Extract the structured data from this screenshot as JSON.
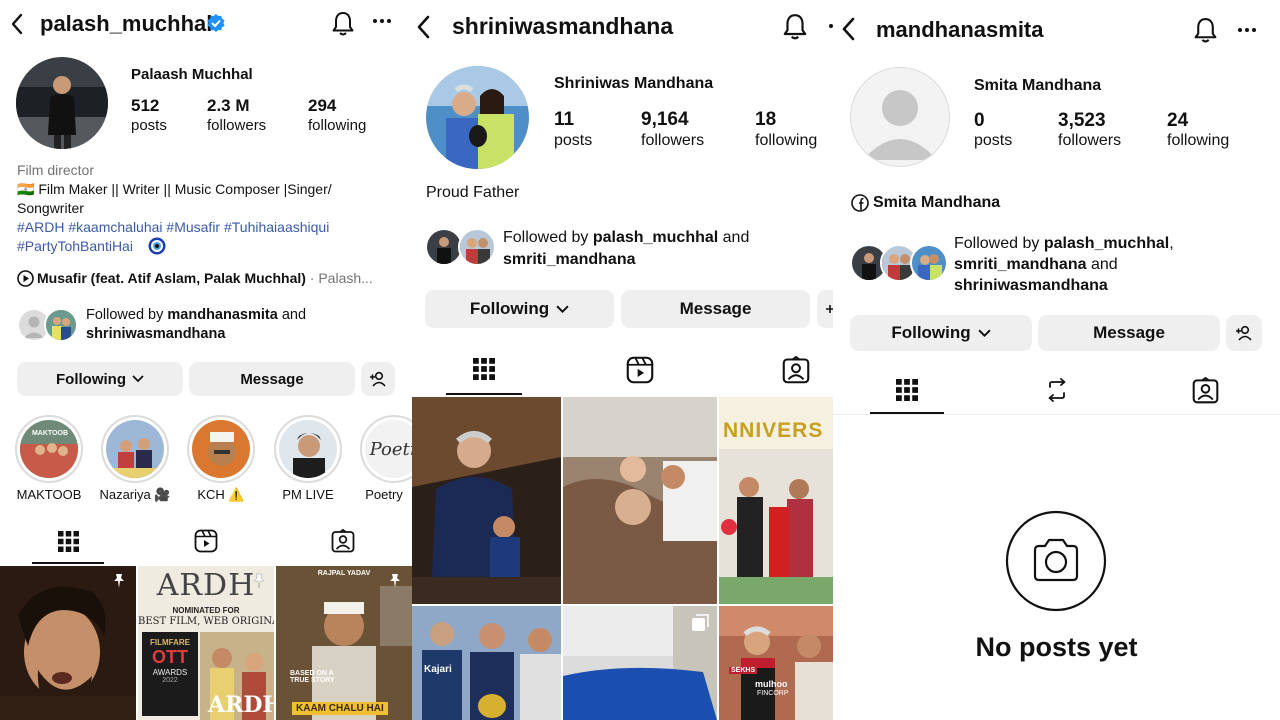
{
  "p1": {
    "username": "palash_muchhal",
    "display_name": "Palaash Muchhal",
    "stats": [
      {
        "num": "512",
        "label": "posts"
      },
      {
        "num": "2.3 M",
        "label": "followers"
      },
      {
        "num": "294",
        "label": "following"
      }
    ],
    "category": "Film director",
    "bio_line1": "🇮🇳 Film Maker || Writer || Music Composer |Singer/",
    "bio_line2": "Songwriter",
    "hashtags_line1": "#ARDH #kaamchaluhai #Musafir #Tuhihaiaashiqui",
    "hashtags_line2": "#PartyTohBantiHai",
    "music_title": "Musafir (feat. Atif Aslam, Palak Muchhal)",
    "music_suffix": "· Palash...",
    "followed_by_prefix": "Followed by",
    "followed_by_user1": "mandhanasmita",
    "followed_by_and": "and",
    "followed_by_user2": "shriniwasmandhana",
    "following_btn": "Following",
    "message_btn": "Message",
    "highlights": [
      {
        "label": "MAKTOOB",
        "inner": "MAKTOOB"
      },
      {
        "label": "Nazariya 🎥",
        "inner": ""
      },
      {
        "label": "KCH ⚠️",
        "inner": ""
      },
      {
        "label": "PM LIVE",
        "inner": ""
      },
      {
        "label": "Poetry",
        "inner": "Poetr"
      }
    ],
    "posts": {
      "p2_title": "ARDH",
      "p2_sub1": "NOMINATED FOR",
      "p2_sub2": "BEST FILM, WEB ORIGINAL",
      "p2_award1": "FILMFARE",
      "p2_award2": "OTT",
      "p2_award3": "AWARDS",
      "p2_year": "2022",
      "p2_bottom": "ARDH",
      "p3_top": "RAJPAL YADAV",
      "p3_story": "BASED ON A TRUE STORY",
      "p3_title": "KAAM CHALU HAI"
    }
  },
  "p2": {
    "username": "shriniwasmandhana",
    "display_name": "Shriniwas Mandhana",
    "stats": [
      {
        "num": "11",
        "label": "posts"
      },
      {
        "num": "9,164",
        "label": "followers"
      },
      {
        "num": "18",
        "label": "following"
      }
    ],
    "bio": "Proud Father",
    "followed_by_prefix": "Followed by",
    "followed_by_user1": "palash_muchhal",
    "followed_by_and": "and",
    "followed_by_user2": "smriti_mandhana",
    "following_btn": "Following",
    "message_btn": "Message",
    "posts": {
      "anniv_text": "NNIVERS",
      "jersey1": "Kajari",
      "jersey2": "mulhoo",
      "jersey3": "FINCORP",
      "jersey4": "SEKHS"
    }
  },
  "p3": {
    "username": "mandhanasmita",
    "display_name": "Smita Mandhana",
    "stats": [
      {
        "num": "0",
        "label": "posts"
      },
      {
        "num": "3,523",
        "label": "followers"
      },
      {
        "num": "24",
        "label": "following"
      }
    ],
    "fb_name": "Smita Mandhana",
    "followed_by_prefix": "Followed by",
    "followed_by_user1": "palash_muchhal",
    "followed_by_comma": ",",
    "followed_by_user2": "smriti_mandhana",
    "followed_by_and": "and",
    "followed_by_user3": "shriniwasmandhana",
    "following_btn": "Following",
    "message_btn": "Message",
    "empty_text": "No posts yet"
  }
}
